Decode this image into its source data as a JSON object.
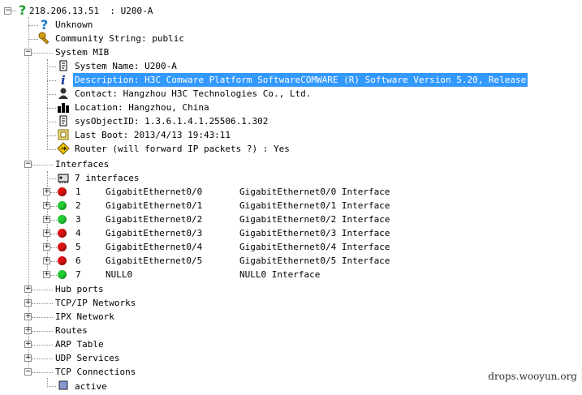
{
  "root": {
    "label": "218.206.13.51  : U200-A",
    "icon": "question-mark-icon"
  },
  "unknown": {
    "label": "Unknown",
    "icon": "question-mark-icon"
  },
  "community": {
    "label": "Community String: public",
    "icon": "key-icon"
  },
  "system_mib": {
    "label": "System MIB",
    "items": [
      {
        "label": "System Name: U200-A",
        "icon": "scroll-icon"
      },
      {
        "label": "Description: H3C Comware Platform SoftwareCOMWARE (R) Software Version 5.20, Release",
        "icon": "info-icon",
        "selected": true
      },
      {
        "label": "Contact: Hangzhou H3C Technologies Co., Ltd.",
        "icon": "person-icon"
      },
      {
        "label": "Location: Hangzhou, China",
        "icon": "city-icon"
      },
      {
        "label": "sysObjectID: 1.3.6.1.4.1.25506.1.302",
        "icon": "scroll-icon"
      },
      {
        "label": "Last Boot: 2013/4/13 19:43:11",
        "icon": "calendar-icon"
      },
      {
        "label": "Router (will forward IP packets ?) : Yes",
        "icon": "router-icon"
      }
    ]
  },
  "interfaces": {
    "label": "Interfaces",
    "count_label": "7 interfaces",
    "items": [
      {
        "num": "1",
        "name": "GigabitEthernet0/0",
        "desc": "GigabitEthernet0/0 Interface",
        "status": "red"
      },
      {
        "num": "2",
        "name": "GigabitEthernet0/1",
        "desc": "GigabitEthernet0/1 Interface",
        "status": "green"
      },
      {
        "num": "3",
        "name": "GigabitEthernet0/2",
        "desc": "GigabitEthernet0/2 Interface",
        "status": "green"
      },
      {
        "num": "4",
        "name": "GigabitEthernet0/3",
        "desc": "GigabitEthernet0/3 Interface",
        "status": "red"
      },
      {
        "num": "5",
        "name": "GigabitEthernet0/4",
        "desc": "GigabitEthernet0/4 Interface",
        "status": "red"
      },
      {
        "num": "6",
        "name": "GigabitEthernet0/5",
        "desc": "GigabitEthernet0/5 Interface",
        "status": "red"
      },
      {
        "num": "7",
        "name": "NULL0",
        "desc": "NULL0 Interface",
        "status": "green"
      }
    ]
  },
  "sections": [
    {
      "label": "Hub ports",
      "toggle": "+"
    },
    {
      "label": "TCP/IP Networks",
      "toggle": "+"
    },
    {
      "label": "IPX Network",
      "toggle": "+"
    },
    {
      "label": "Routes",
      "toggle": "+"
    },
    {
      "label": "ARP Table",
      "toggle": "+"
    },
    {
      "label": "UDP Services",
      "toggle": "+"
    },
    {
      "label": "TCP Connections",
      "toggle": "-"
    }
  ],
  "partial_child": {
    "label": "active"
  },
  "watermark": "drops.wooyun.org",
  "colors": {
    "selection": "#3399ff",
    "status_down": "#dd1111",
    "status_up": "#22cc33"
  }
}
